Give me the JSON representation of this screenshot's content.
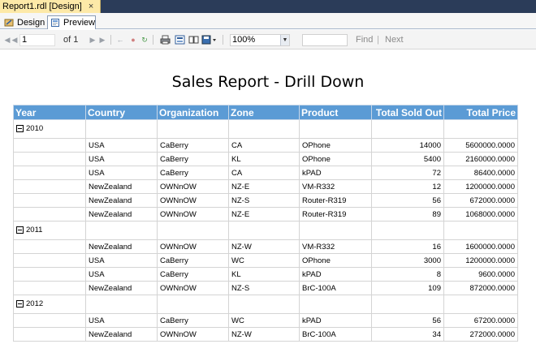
{
  "document_tab": {
    "title": "Report1.rdl [Design]",
    "close": "×"
  },
  "view_tabs": {
    "design": "Design",
    "preview": "Preview"
  },
  "toolbar": {
    "page": "1",
    "of_label": "of 1",
    "zoom": "100%",
    "find": "Find",
    "separator": "|",
    "next": "Next"
  },
  "report": {
    "title": "Sales Report - Drill Down",
    "columns": [
      "Year",
      "Country",
      "Organization",
      "Zone",
      "Product",
      "Total Sold Out",
      "Total Price"
    ],
    "groups": [
      {
        "year": "2010",
        "rows": [
          [
            "USA",
            "CaBerry",
            "CA",
            "OPhone",
            "14000",
            "5600000.0000"
          ],
          [
            "USA",
            "CaBerry",
            "KL",
            "OPhone",
            "5400",
            "2160000.0000"
          ],
          [
            "USA",
            "CaBerry",
            "CA",
            "kPAD",
            "72",
            "86400.0000"
          ],
          [
            "NewZealand",
            "OWNnOW",
            "NZ-E",
            "VM-R332",
            "12",
            "1200000.0000"
          ],
          [
            "NewZealand",
            "OWNnOW",
            "NZ-S",
            "Router-R319",
            "56",
            "672000.0000"
          ],
          [
            "NewZealand",
            "OWNnOW",
            "NZ-E",
            "Router-R319",
            "89",
            "1068000.0000"
          ]
        ]
      },
      {
        "year": "2011",
        "rows": [
          [
            "NewZealand",
            "OWNnOW",
            "NZ-W",
            "VM-R332",
            "16",
            "1600000.0000"
          ],
          [
            "USA",
            "CaBerry",
            "WC",
            "OPhone",
            "3000",
            "1200000.0000"
          ],
          [
            "USA",
            "CaBerry",
            "KL",
            "kPAD",
            "8",
            "9600.0000"
          ],
          [
            "NewZealand",
            "OWNnOW",
            "NZ-S",
            "BrC-100A",
            "109",
            "872000.0000"
          ]
        ]
      },
      {
        "year": "2012",
        "rows": [
          [
            "USA",
            "CaBerry",
            "WC",
            "kPAD",
            "56",
            "67200.0000"
          ],
          [
            "NewZealand",
            "OWNnOW",
            "NZ-W",
            "BrC-100A",
            "34",
            "272000.0000"
          ]
        ]
      }
    ]
  },
  "colors": {
    "header_bg": "#5b9bd5",
    "doc_strip": "#2b3c59",
    "doc_tab": "#fde9a8"
  }
}
